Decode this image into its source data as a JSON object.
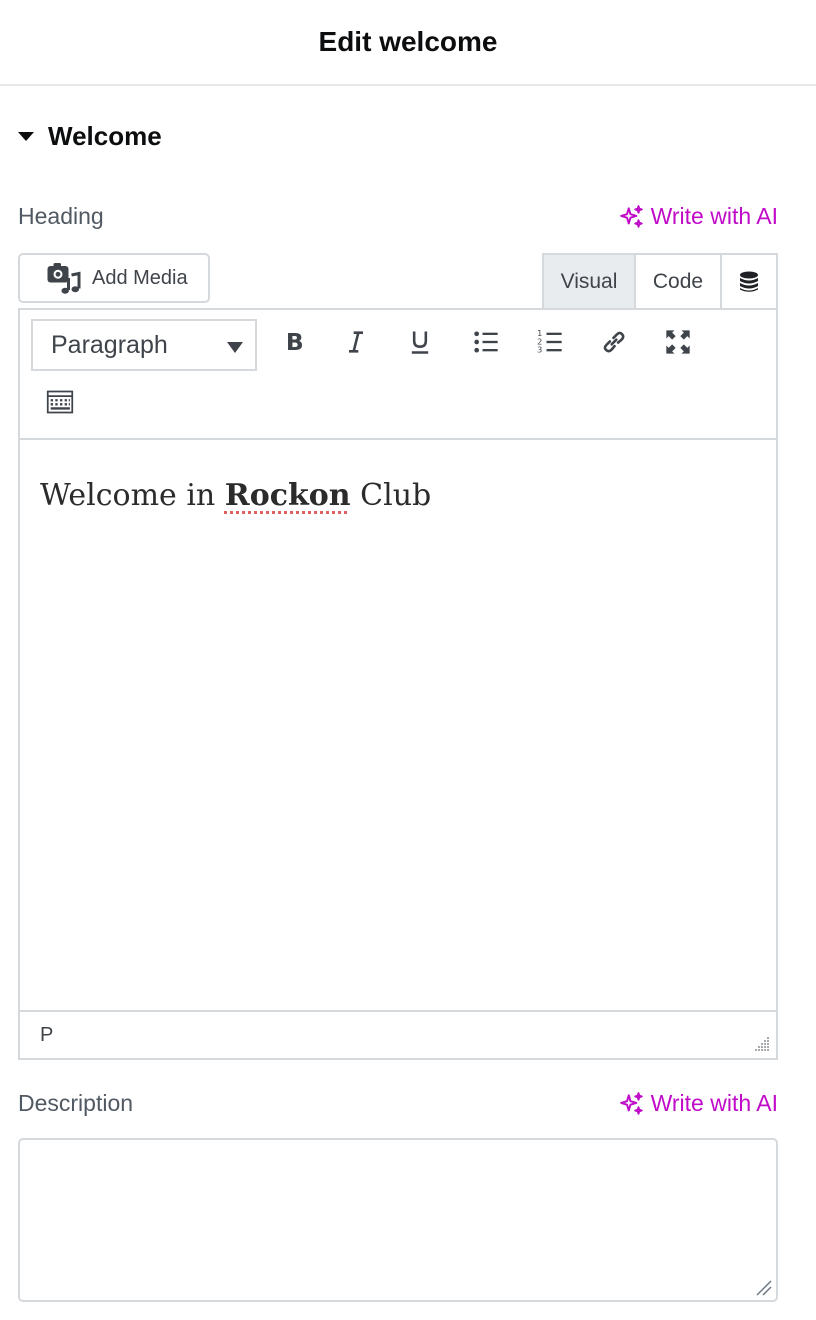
{
  "header": {
    "title": "Edit welcome"
  },
  "section": {
    "title": "Welcome",
    "icon": "caret-down-icon"
  },
  "heading_field": {
    "label": "Heading",
    "ai_label": "Write with AI",
    "ai_icon": "sparkle-icon",
    "add_media_label": "Add Media",
    "add_media_icon": "media-icon",
    "tabs": [
      "Visual",
      "Code"
    ],
    "tab_db_icon": "database-icon",
    "active_tab": "Visual",
    "format_select": "Paragraph",
    "toolbar_icons": [
      "bold-icon",
      "italic-icon",
      "underline-icon",
      "bullet-list-icon",
      "numbered-list-icon",
      "link-icon",
      "fullscreen-icon",
      "keyboard-icon"
    ],
    "content": {
      "before": "Welcome in ",
      "brand": "Rockon",
      "after": " Club"
    },
    "status_path": "P"
  },
  "description_field": {
    "label": "Description",
    "ai_label": "Write with AI",
    "ai_icon": "sparkle-icon",
    "value": ""
  },
  "colors": {
    "ai_accent": "#c00bc9",
    "border": "#d5d8dc",
    "active_tab_bg": "#e9ecef"
  }
}
